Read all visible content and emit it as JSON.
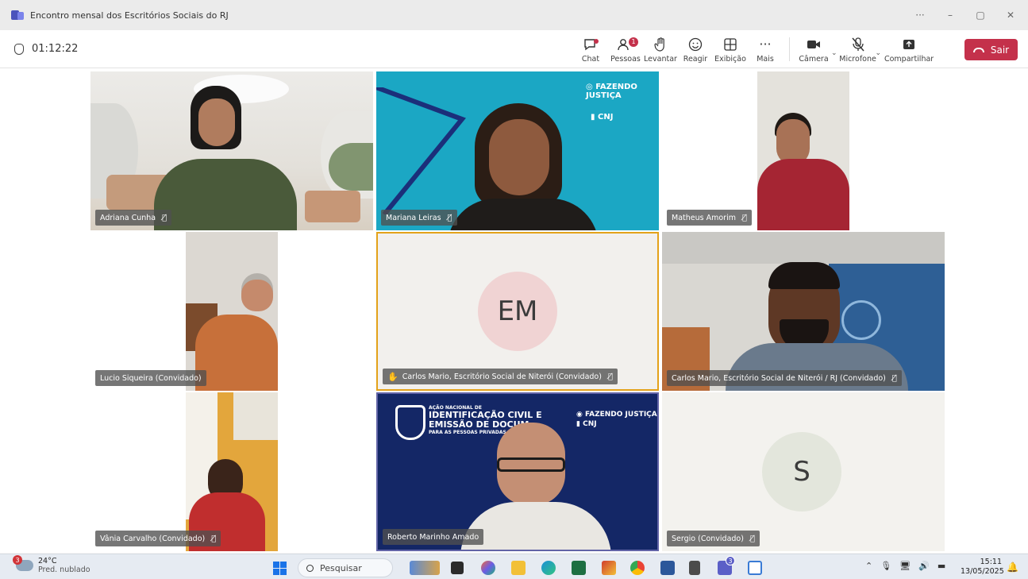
{
  "window": {
    "title": "Encontro mensal dos Escritórios Sociais do RJ",
    "controls": [
      "···",
      "–",
      "▢",
      "✕"
    ]
  },
  "toolbar": {
    "timer": "01:12:22",
    "chat_label": "Chat",
    "people_label": "Pessoas",
    "people_badge": "1",
    "raise_label": "Levantar",
    "react_label": "Reagir",
    "view_label": "Exibição",
    "more_label": "Mais",
    "camera_label": "Câmera",
    "mic_label": "Microfone",
    "share_label": "Compartilhar",
    "leave_label": "Sair",
    "leave_color": "#c4314b"
  },
  "participants": [
    {
      "name": "Adriana Cunha",
      "muted": true
    },
    {
      "name": "Mariana Leiras",
      "muted": true,
      "background_logo_1": "FAZENDO JUSTIÇA",
      "background_logo_2": "CNJ"
    },
    {
      "name": "Matheus Amorim",
      "muted": true
    },
    {
      "name": "Lucio Siqueira (Convidado)",
      "muted": false
    },
    {
      "name": "Carlos Mario, Escritório Social de Niterói (Convidado)",
      "muted": true,
      "initials": "EM",
      "hand_raised": true
    },
    {
      "name": "Carlos Mario, Escritório Social de Niterói / RJ (Convidado)",
      "muted": true
    },
    {
      "name": "Vânia Carvalho (Convidado)",
      "muted": true
    },
    {
      "name": "Roberto Marinho Amado",
      "muted": false,
      "banner_small": "AÇÃO NACIONAL DE",
      "banner_line1": "IDENTIFICAÇÃO CIVIL E",
      "banner_line2": "EMISSÃO DE DOCUM",
      "banner_line3": "PARA AS PESSOAS PRIVADAS D"
    },
    {
      "name": "Sergio (Convidado)",
      "muted": true,
      "initials": "S"
    }
  ],
  "taskbar": {
    "weather_badge": "3",
    "temperature": "24°C",
    "weather_desc": "Pred. nublado",
    "search_placeholder": "Pesquisar",
    "teams_badge": "3",
    "time": "15:11",
    "date": "13/05/2025"
  }
}
